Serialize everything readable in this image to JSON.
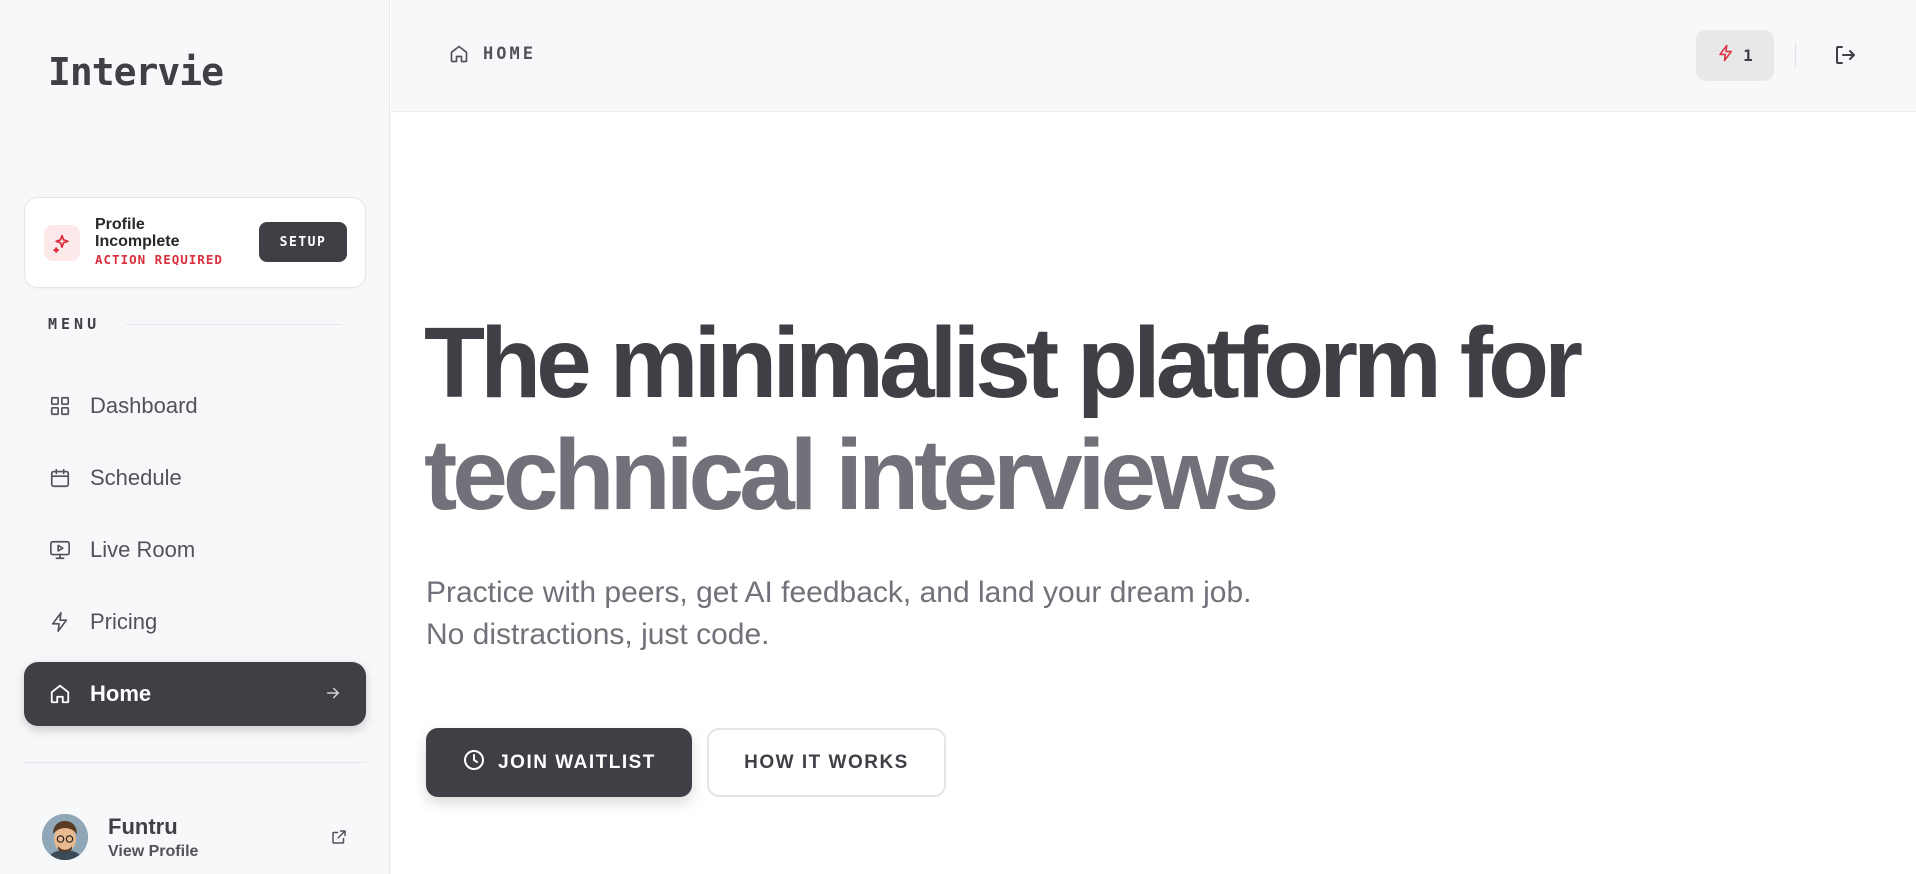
{
  "app": {
    "logo": "Intervie"
  },
  "profile_card": {
    "title": "Profile Incomplete",
    "status": "ACTION REQUIRED",
    "button": "SETUP"
  },
  "menu": {
    "label": "MENU",
    "items": [
      {
        "label": "Dashboard",
        "icon": "grid-icon"
      },
      {
        "label": "Schedule",
        "icon": "calendar-icon"
      },
      {
        "label": "Live Room",
        "icon": "monitor-play-icon"
      },
      {
        "label": "Pricing",
        "icon": "lightning-icon"
      },
      {
        "label": "Home",
        "icon": "home-icon",
        "active": true
      }
    ]
  },
  "user": {
    "name": "Funtru",
    "link": "View Profile"
  },
  "header": {
    "breadcrumb": "HOME",
    "credits": "1"
  },
  "hero": {
    "line1": "The minimalist platform for",
    "line2": "technical interviews",
    "subtitle": "Practice with peers, get AI feedback, and land your dream job. No distractions, just code.",
    "primary_button": "JOIN WAITLIST",
    "secondary_button": "HOW IT WORKS"
  },
  "colors": {
    "accent": "#dc2f3e",
    "dark": "#3f3f46",
    "muted": "#71717a"
  }
}
